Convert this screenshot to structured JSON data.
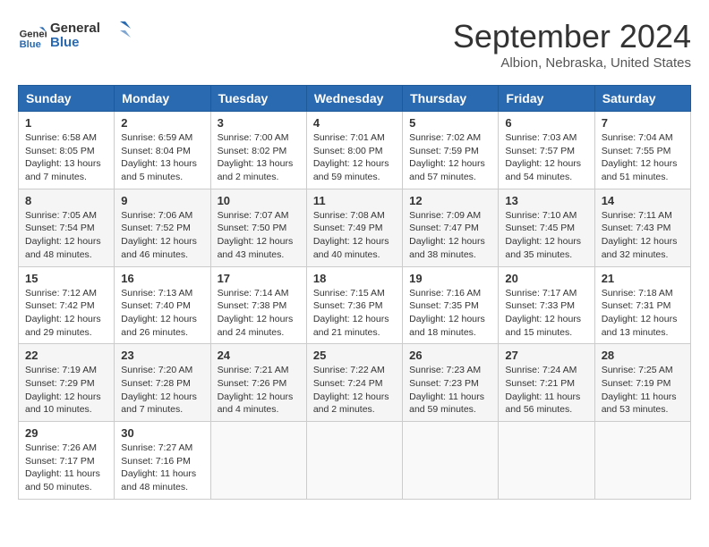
{
  "header": {
    "logo_line1": "General",
    "logo_line2": "Blue",
    "month_title": "September 2024",
    "location": "Albion, Nebraska, United States"
  },
  "days_of_week": [
    "Sunday",
    "Monday",
    "Tuesday",
    "Wednesday",
    "Thursday",
    "Friday",
    "Saturday"
  ],
  "weeks": [
    [
      {
        "day": "1",
        "lines": [
          "Sunrise: 6:58 AM",
          "Sunset: 8:05 PM",
          "Daylight: 13 hours",
          "and 7 minutes."
        ]
      },
      {
        "day": "2",
        "lines": [
          "Sunrise: 6:59 AM",
          "Sunset: 8:04 PM",
          "Daylight: 13 hours",
          "and 5 minutes."
        ]
      },
      {
        "day": "3",
        "lines": [
          "Sunrise: 7:00 AM",
          "Sunset: 8:02 PM",
          "Daylight: 13 hours",
          "and 2 minutes."
        ]
      },
      {
        "day": "4",
        "lines": [
          "Sunrise: 7:01 AM",
          "Sunset: 8:00 PM",
          "Daylight: 12 hours",
          "and 59 minutes."
        ]
      },
      {
        "day": "5",
        "lines": [
          "Sunrise: 7:02 AM",
          "Sunset: 7:59 PM",
          "Daylight: 12 hours",
          "and 57 minutes."
        ]
      },
      {
        "day": "6",
        "lines": [
          "Sunrise: 7:03 AM",
          "Sunset: 7:57 PM",
          "Daylight: 12 hours",
          "and 54 minutes."
        ]
      },
      {
        "day": "7",
        "lines": [
          "Sunrise: 7:04 AM",
          "Sunset: 7:55 PM",
          "Daylight: 12 hours",
          "and 51 minutes."
        ]
      }
    ],
    [
      {
        "day": "8",
        "lines": [
          "Sunrise: 7:05 AM",
          "Sunset: 7:54 PM",
          "Daylight: 12 hours",
          "and 48 minutes."
        ]
      },
      {
        "day": "9",
        "lines": [
          "Sunrise: 7:06 AM",
          "Sunset: 7:52 PM",
          "Daylight: 12 hours",
          "and 46 minutes."
        ]
      },
      {
        "day": "10",
        "lines": [
          "Sunrise: 7:07 AM",
          "Sunset: 7:50 PM",
          "Daylight: 12 hours",
          "and 43 minutes."
        ]
      },
      {
        "day": "11",
        "lines": [
          "Sunrise: 7:08 AM",
          "Sunset: 7:49 PM",
          "Daylight: 12 hours",
          "and 40 minutes."
        ]
      },
      {
        "day": "12",
        "lines": [
          "Sunrise: 7:09 AM",
          "Sunset: 7:47 PM",
          "Daylight: 12 hours",
          "and 38 minutes."
        ]
      },
      {
        "day": "13",
        "lines": [
          "Sunrise: 7:10 AM",
          "Sunset: 7:45 PM",
          "Daylight: 12 hours",
          "and 35 minutes."
        ]
      },
      {
        "day": "14",
        "lines": [
          "Sunrise: 7:11 AM",
          "Sunset: 7:43 PM",
          "Daylight: 12 hours",
          "and 32 minutes."
        ]
      }
    ],
    [
      {
        "day": "15",
        "lines": [
          "Sunrise: 7:12 AM",
          "Sunset: 7:42 PM",
          "Daylight: 12 hours",
          "and 29 minutes."
        ]
      },
      {
        "day": "16",
        "lines": [
          "Sunrise: 7:13 AM",
          "Sunset: 7:40 PM",
          "Daylight: 12 hours",
          "and 26 minutes."
        ]
      },
      {
        "day": "17",
        "lines": [
          "Sunrise: 7:14 AM",
          "Sunset: 7:38 PM",
          "Daylight: 12 hours",
          "and 24 minutes."
        ]
      },
      {
        "day": "18",
        "lines": [
          "Sunrise: 7:15 AM",
          "Sunset: 7:36 PM",
          "Daylight: 12 hours",
          "and 21 minutes."
        ]
      },
      {
        "day": "19",
        "lines": [
          "Sunrise: 7:16 AM",
          "Sunset: 7:35 PM",
          "Daylight: 12 hours",
          "and 18 minutes."
        ]
      },
      {
        "day": "20",
        "lines": [
          "Sunrise: 7:17 AM",
          "Sunset: 7:33 PM",
          "Daylight: 12 hours",
          "and 15 minutes."
        ]
      },
      {
        "day": "21",
        "lines": [
          "Sunrise: 7:18 AM",
          "Sunset: 7:31 PM",
          "Daylight: 12 hours",
          "and 13 minutes."
        ]
      }
    ],
    [
      {
        "day": "22",
        "lines": [
          "Sunrise: 7:19 AM",
          "Sunset: 7:29 PM",
          "Daylight: 12 hours",
          "and 10 minutes."
        ]
      },
      {
        "day": "23",
        "lines": [
          "Sunrise: 7:20 AM",
          "Sunset: 7:28 PM",
          "Daylight: 12 hours",
          "and 7 minutes."
        ]
      },
      {
        "day": "24",
        "lines": [
          "Sunrise: 7:21 AM",
          "Sunset: 7:26 PM",
          "Daylight: 12 hours",
          "and 4 minutes."
        ]
      },
      {
        "day": "25",
        "lines": [
          "Sunrise: 7:22 AM",
          "Sunset: 7:24 PM",
          "Daylight: 12 hours",
          "and 2 minutes."
        ]
      },
      {
        "day": "26",
        "lines": [
          "Sunrise: 7:23 AM",
          "Sunset: 7:23 PM",
          "Daylight: 11 hours",
          "and 59 minutes."
        ]
      },
      {
        "day": "27",
        "lines": [
          "Sunrise: 7:24 AM",
          "Sunset: 7:21 PM",
          "Daylight: 11 hours",
          "and 56 minutes."
        ]
      },
      {
        "day": "28",
        "lines": [
          "Sunrise: 7:25 AM",
          "Sunset: 7:19 PM",
          "Daylight: 11 hours",
          "and 53 minutes."
        ]
      }
    ],
    [
      {
        "day": "29",
        "lines": [
          "Sunrise: 7:26 AM",
          "Sunset: 7:17 PM",
          "Daylight: 11 hours",
          "and 50 minutes."
        ]
      },
      {
        "day": "30",
        "lines": [
          "Sunrise: 7:27 AM",
          "Sunset: 7:16 PM",
          "Daylight: 11 hours",
          "and 48 minutes."
        ]
      },
      null,
      null,
      null,
      null,
      null
    ]
  ]
}
